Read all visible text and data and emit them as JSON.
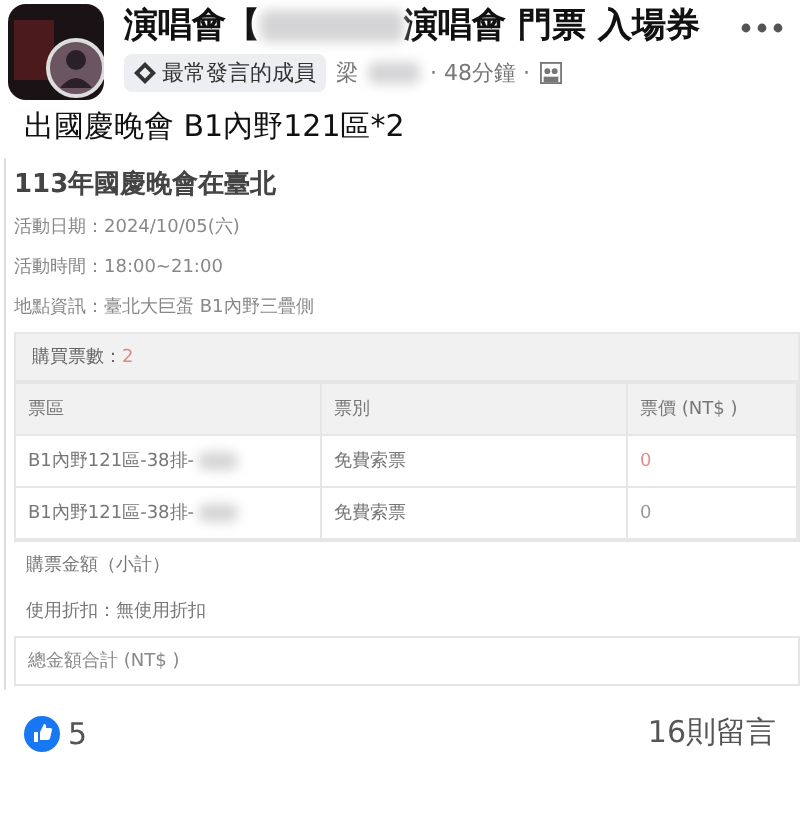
{
  "post": {
    "title_start": "演唱會【",
    "title_end": "演唱會 門票 入場券",
    "badge": "最常發言的成員",
    "author": "梁",
    "time": "· 48分鐘 ·",
    "text": "出國慶晚會 B1內野121區*2"
  },
  "ticket": {
    "event": "113年國慶晚會在臺北",
    "info": [
      "活動日期：2024/10/05(六)",
      "活動時間：18:00~21:00",
      "地點資訊：臺北大巨蛋 B1內野三疊側"
    ],
    "count_label": "購買票數：",
    "count": "2",
    "columns": [
      "票區",
      "票別",
      "票價 (NT$ )"
    ],
    "rows": [
      {
        "zone": "B1內野121區-38排-",
        "type": "免費索票",
        "price": "0",
        "highlight": true
      },
      {
        "zone": "B1內野121區-38排-",
        "type": "免費索票",
        "price": "0",
        "highlight": false
      }
    ],
    "subtotal": "購票金額（小計）",
    "discount": "使用折扣：無使用折扣",
    "total": "總金額合計 (NT$ )"
  },
  "footer": {
    "likes": "5",
    "comments": "16則留言"
  }
}
